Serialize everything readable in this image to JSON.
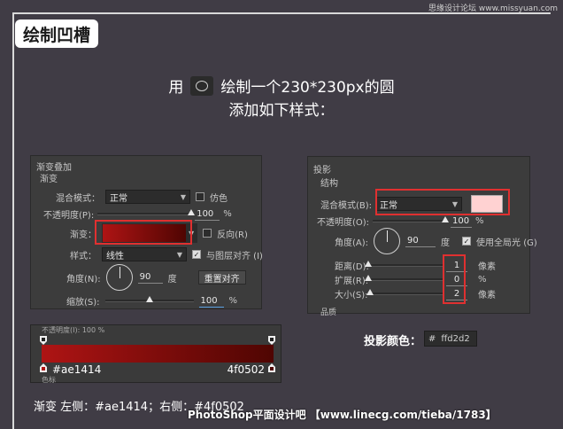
{
  "watermark_top": "思缘设计论坛 www.missyuan.com",
  "title": "绘制凹槽",
  "intro": {
    "line1_prefix": "用",
    "line1_suffix": "绘制一个230*230px的圆",
    "line2": "添加如下样式："
  },
  "gradient_panel": {
    "header": "渐变叠加",
    "section": "渐变",
    "blend_label": "混合模式：",
    "blend_value": "正常",
    "dither_label": "仿色",
    "opacity_label": "不透明度(P):",
    "opacity_value": "100",
    "opacity_unit": "%",
    "opacity_fraction": 1.0,
    "gradient_label": "渐变：",
    "reverse_label": "反向(R)",
    "style_label": "样式：",
    "style_value": "线性",
    "align_label": "与图层对齐 (I)",
    "angle_label": "角度(N):",
    "angle_value": "90",
    "angle_unit": "度",
    "reset_button": "重置对齐",
    "scale_label": "缩放(S):",
    "scale_value": "100",
    "scale_unit": "%",
    "scale_fraction": 0.5
  },
  "shadow_panel": {
    "header": "投影",
    "section": "结构",
    "blend_label": "混合模式(B):",
    "blend_value": "正常",
    "opacity_label": "不透明度(O):",
    "opacity_value": "100",
    "opacity_unit": "%",
    "angle_label": "角度(A):",
    "angle_value": "90",
    "angle_unit": "度",
    "global_light_label": "使用全局光 (G)",
    "distance_label": "距离(D):",
    "distance_value": "1",
    "distance_unit": "像素",
    "spread_label": "扩展(R):",
    "spread_value": "0",
    "spread_unit": "%",
    "size_label": "大小(S):",
    "size_value": "2",
    "size_unit": "像素",
    "bottom_cut": "品质"
  },
  "gradient_editor": {
    "top_cut": "不透明度(I):  100  %",
    "left_hex": "#ae1414",
    "right_hex": "4f0502",
    "bottom_cut": "色标"
  },
  "shadow_color": {
    "label": "投影颜色：",
    "hash": "#",
    "hex": "ffd2d2"
  },
  "caption": "渐变 左侧：#ae1414；右侧：#4f0502",
  "footer": "PhotoShop平面设计吧 【www.linecg.com/tieba/1783】",
  "colors": {
    "gradient_left": "#ae1414",
    "gradient_right": "#4f0502",
    "shadow": "#ffd2d2",
    "highlight": "#e03030"
  }
}
